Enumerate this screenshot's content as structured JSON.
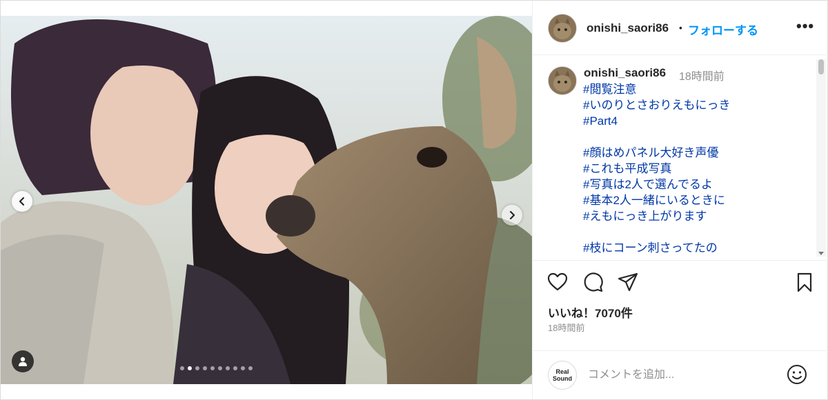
{
  "post": {
    "username": "onishi_saori86",
    "separator": "•",
    "follow_label": "フォローする",
    "more_label": "•••"
  },
  "caption": {
    "username": "onishi_saori86",
    "time": "18時間前",
    "lines": [
      "#閲覧注意",
      "#いのりとさおりえもにっき",
      "#Part4",
      "",
      "#顔はめパネル大好き声優",
      "#これも平成写真",
      "#写真は2人で選んでるよ",
      "#基本2人一緒にいるときに",
      "#えもにっき上がります",
      "",
      "#枝にコーン刺さってたの"
    ]
  },
  "likes": "いいね！7070件",
  "posted": "18時間前",
  "comment": {
    "placeholder": "コメントを追加...",
    "logo_top": "Real",
    "logo_bottom": "Sound"
  },
  "carousel": {
    "total": 10,
    "active": 2
  },
  "icons": [
    "chevron-left-icon",
    "chevron-right-icon",
    "user-tag-icon",
    "heart-icon",
    "comment-icon",
    "share-icon",
    "bookmark-icon",
    "emoji-icon"
  ],
  "colors": {
    "link": "#0038a8",
    "follow": "#0095f6",
    "text": "#262626",
    "muted": "#8e8e8e"
  }
}
